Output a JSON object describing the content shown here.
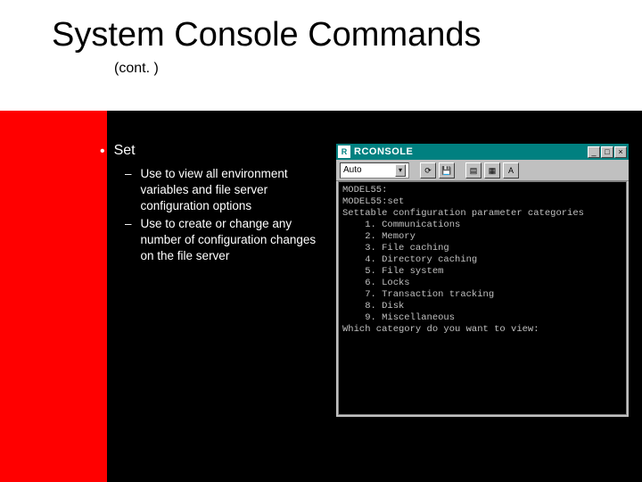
{
  "header": {
    "title": "System Console Commands",
    "subtitle": "(cont. )"
  },
  "bullet": {
    "label": "Set",
    "subs": [
      "Use to view all environment variables and file server configuration options",
      "Use to create or change any number of configuration changes on the file server"
    ]
  },
  "rconsole": {
    "title": "RCONSOLE",
    "combo_value": "Auto",
    "toolbar_icons": [
      "sync",
      "save",
      "screen1",
      "screen2",
      "bold"
    ],
    "terminal_lines": [
      "MODEL55:",
      "MODEL55:set",
      "Settable configuration parameter categories",
      "    1. Communications",
      "    2. Memory",
      "    3. File caching",
      "    4. Directory caching",
      "    5. File system",
      "    6. Locks",
      "    7. Transaction tracking",
      "    8. Disk",
      "    9. Miscellaneous",
      "Which category do you want to view:"
    ]
  },
  "glyphs": {
    "min": "_",
    "max": "□",
    "close": "×",
    "dropdown": "▾",
    "icon_sync": "⟳",
    "icon_save": "💾",
    "icon_s1": "▤",
    "icon_s2": "▦",
    "icon_bold": "A"
  }
}
